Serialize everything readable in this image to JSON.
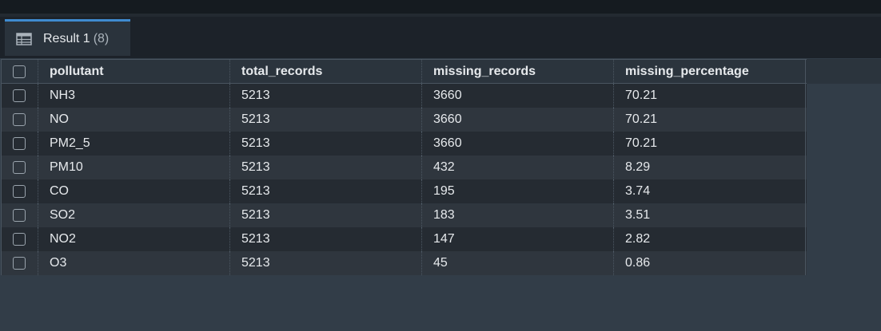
{
  "result_tab": {
    "label": "Result 1",
    "count": "(8)",
    "icon": "grid-table-icon"
  },
  "table": {
    "columns": [
      "pollutant",
      "total_records",
      "missing_records",
      "missing_percentage"
    ],
    "rows": [
      [
        "NH3",
        "5213",
        "3660",
        "70.21"
      ],
      [
        "NO",
        "5213",
        "3660",
        "70.21"
      ],
      [
        "PM2_5",
        "5213",
        "3660",
        "70.21"
      ],
      [
        "PM10",
        "5213",
        "432",
        "8.29"
      ],
      [
        "CO",
        "5213",
        "195",
        "3.74"
      ],
      [
        "SO2",
        "5213",
        "183",
        "3.51"
      ],
      [
        "NO2",
        "5213",
        "147",
        "2.82"
      ],
      [
        "O3",
        "5213",
        "45",
        "0.86"
      ]
    ]
  },
  "colors": {
    "accent": "#3f8bd0",
    "background": "#323d48"
  }
}
